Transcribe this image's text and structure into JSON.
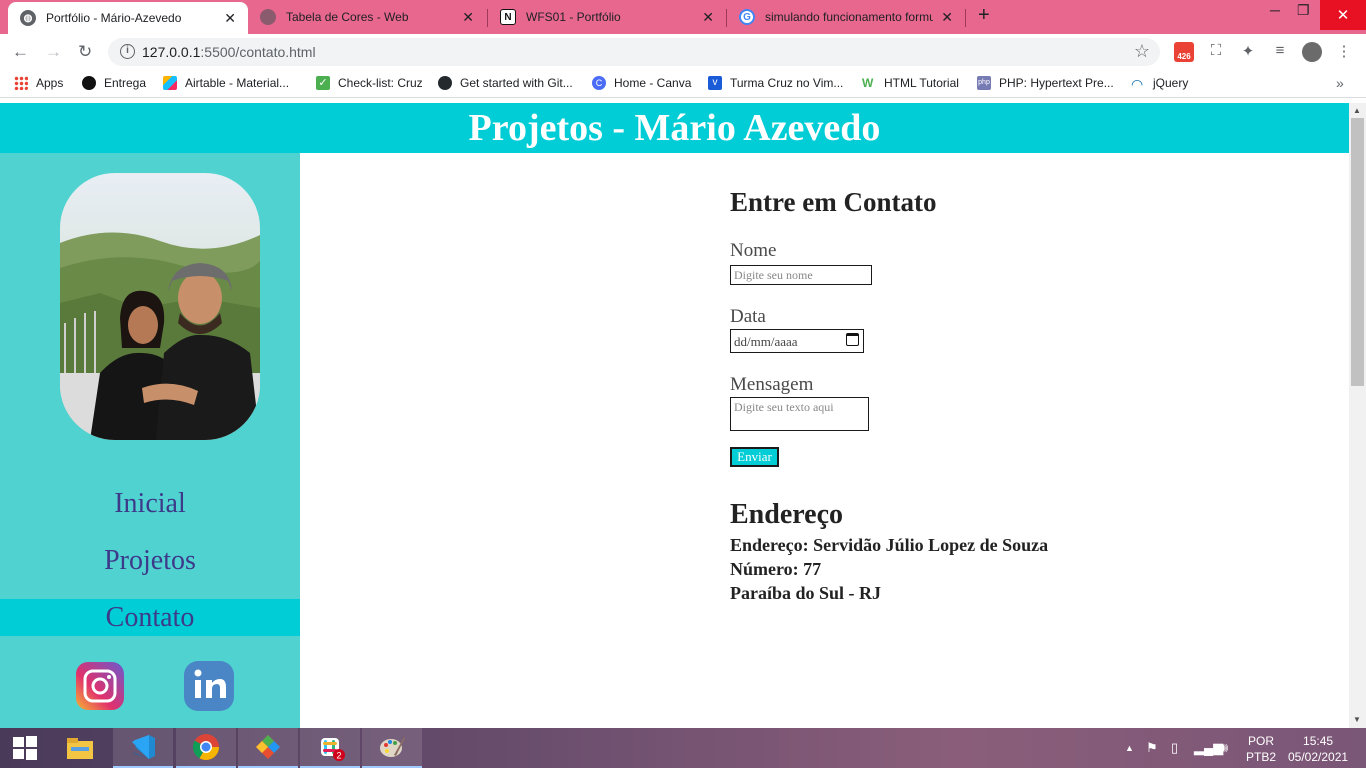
{
  "browser": {
    "tabs": [
      {
        "title": "Portfólio - Mário-Azevedo",
        "active": true
      },
      {
        "title": "Tabela de Cores - Web",
        "active": false
      },
      {
        "title": "WFS01 - Portfólio",
        "active": false
      },
      {
        "title": "simulando funcionamento formu",
        "active": false
      }
    ],
    "close_glyph": "✕",
    "new_tab_glyph": "+",
    "url_host": "127.0.0.1",
    "url_path": ":5500/contato.html",
    "gmail_count": "426",
    "bookmarks": [
      {
        "label": "Apps",
        "icon": "apps-grid-icon",
        "color": "#4285f4"
      },
      {
        "label": "Entrega",
        "icon": "black-circle-icon",
        "color": "#111111"
      },
      {
        "label": "Airtable - Material...",
        "icon": "airtable-icon",
        "color": "#fcb400"
      },
      {
        "label": "Check-list: Cruz",
        "icon": "checkbox-icon",
        "color": "#4caf50"
      },
      {
        "label": "Get started with Git...",
        "icon": "github-icon",
        "color": "#24292e"
      },
      {
        "label": "Home - Canva",
        "icon": "canva-icon",
        "color": "#4a6cf7"
      },
      {
        "label": "Turma Cruz no Vim...",
        "icon": "vimeo-icon",
        "color": "#1a5bd8"
      },
      {
        "label": "HTML Tutorial",
        "icon": "w3schools-icon",
        "color": "#4caf50"
      },
      {
        "label": "PHP: Hypertext Pre...",
        "icon": "php-icon",
        "color": "#777bb3"
      },
      {
        "label": "jQuery",
        "icon": "jquery-icon",
        "color": "#0769ad"
      }
    ],
    "more_glyph": "»"
  },
  "site": {
    "title": "Projetos - Mário Azevedo",
    "header_color": "#00cdd5",
    "sidebar_color": "#4fd2d0",
    "nav": [
      {
        "label": "Inicial",
        "active": false
      },
      {
        "label": "Projetos",
        "active": false
      },
      {
        "label": "Contato",
        "active": true
      }
    ],
    "social": [
      {
        "name": "instagram-icon"
      },
      {
        "name": "linkedin-icon"
      }
    ]
  },
  "contact": {
    "heading": "Entre em Contato",
    "name_label": "Nome",
    "name_placeholder": "Digite seu nome",
    "date_label": "Data",
    "date_placeholder": "dd/mm/aaaa",
    "message_label": "Mensagem",
    "message_placeholder": "Digite seu texto aqui",
    "submit_label": "Enviar"
  },
  "address": {
    "heading": "Endereço",
    "street": "Endereço: Servidão Júlio Lopez de Souza",
    "number": "Número: 77",
    "city": "Paraíba do Sul - RJ"
  },
  "taskbar": {
    "apps": [
      "windows-start-icon",
      "file-explorer-icon",
      "vscode-icon",
      "chrome-icon",
      "git-icon",
      "slack-icon",
      "paint-icon"
    ],
    "lang_top": "POR",
    "lang_bottom": "PTB2",
    "time": "15:45",
    "date": "05/02/2021",
    "slack_badge": "2"
  }
}
